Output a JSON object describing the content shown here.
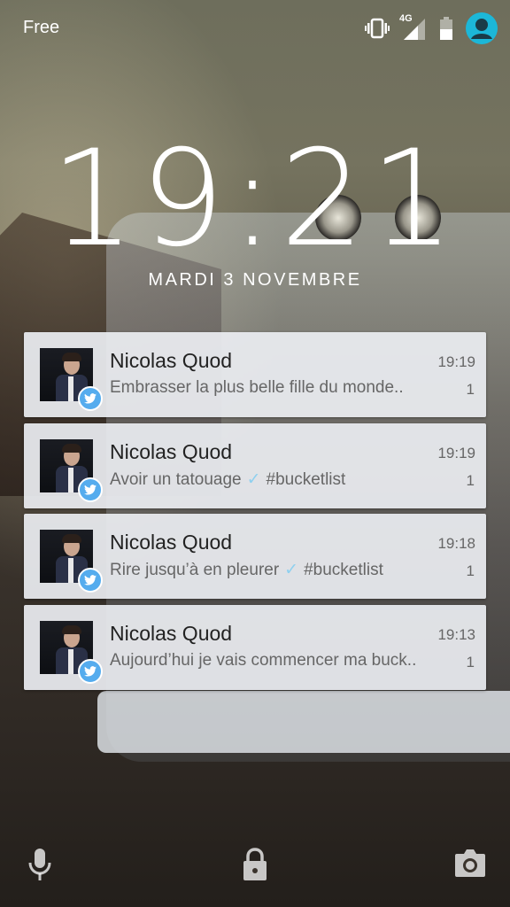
{
  "status_bar": {
    "carrier": "Free",
    "network": "4G",
    "icons": [
      "vibrate-icon",
      "signal-icon",
      "battery-icon",
      "user-avatar-icon"
    ]
  },
  "lockscreen": {
    "time": "19:21",
    "date": "MARDI 3 NOVEMBRE"
  },
  "notifications": [
    {
      "sender": "Nicolas Quod",
      "time": "19:19",
      "text": "Embrasser la plus belle fille du monde..",
      "count": "1",
      "tick": "",
      "tag": ""
    },
    {
      "sender": "Nicolas Quod",
      "time": "19:19",
      "text": "Avoir un tatouage",
      "count": "1",
      "tick": "✓",
      "tag": "#bucketlist"
    },
    {
      "sender": "Nicolas Quod",
      "time": "19:18",
      "text": "Rire jusqu’à en pleurer",
      "count": "1",
      "tick": "✓",
      "tag": "#bucketlist"
    },
    {
      "sender": "Nicolas Quod",
      "time": "19:13",
      "text": "Aujourd’hui je vais commencer ma buck..",
      "count": "1",
      "tick": "",
      "tag": ""
    }
  ],
  "bottom_bar": {
    "icons": [
      "microphone-icon",
      "lock-icon",
      "camera-icon"
    ]
  },
  "colors": {
    "twitter_badge": "#55acee",
    "avatar_ring": "#1cb7d8",
    "notification_bg": "#eceef2"
  }
}
